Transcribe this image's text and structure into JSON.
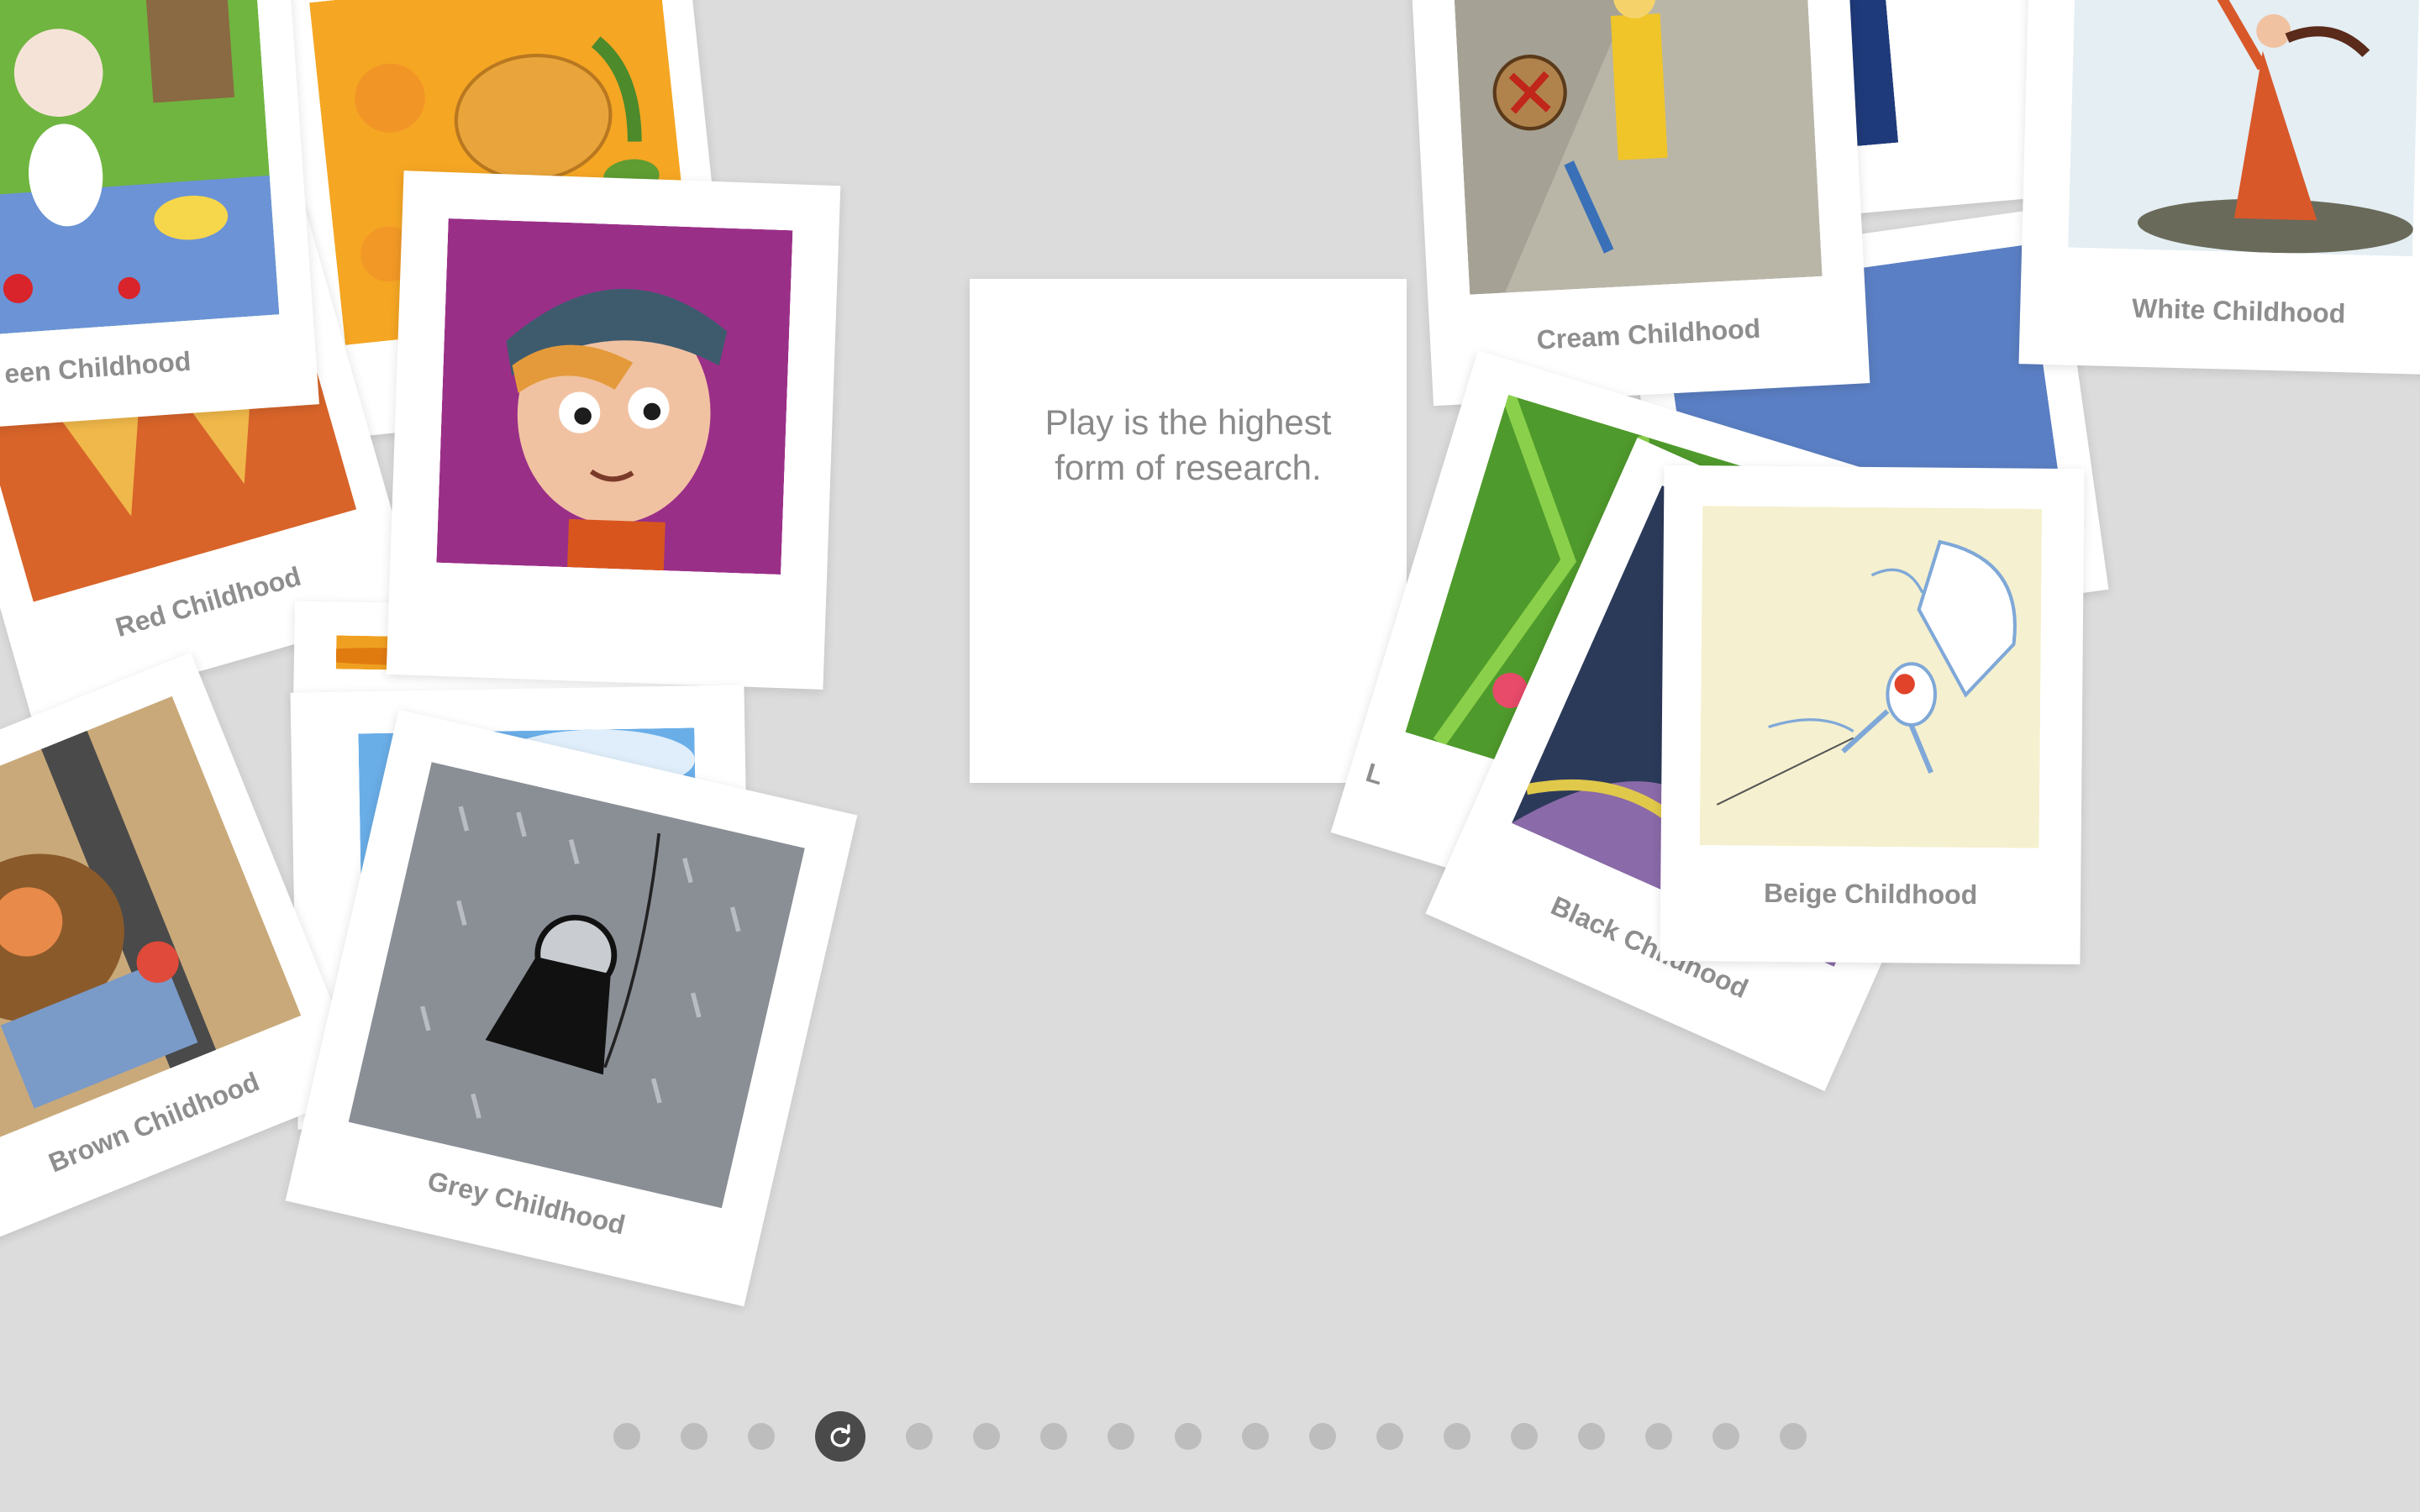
{
  "quote": {
    "line1": "Play is the highest",
    "line2": "form of research."
  },
  "cards": {
    "green": "een Childhood",
    "red": "Red Childhood",
    "brown": "Brown Childhood",
    "grey": "Grey Childhood",
    "cream": "Cream Childhood",
    "white": "White Childhood",
    "black": "Black Childhood",
    "beige": "Beige Childhood",
    "lime": "L"
  },
  "pager": {
    "total": 18,
    "active_index": 3,
    "active_icon": "rotate-icon"
  },
  "colors": {
    "background": "#dcdcdc",
    "caption": "#8e8e8e",
    "dot": "#bdbdbd",
    "dot_active": "#4a4a4a"
  }
}
